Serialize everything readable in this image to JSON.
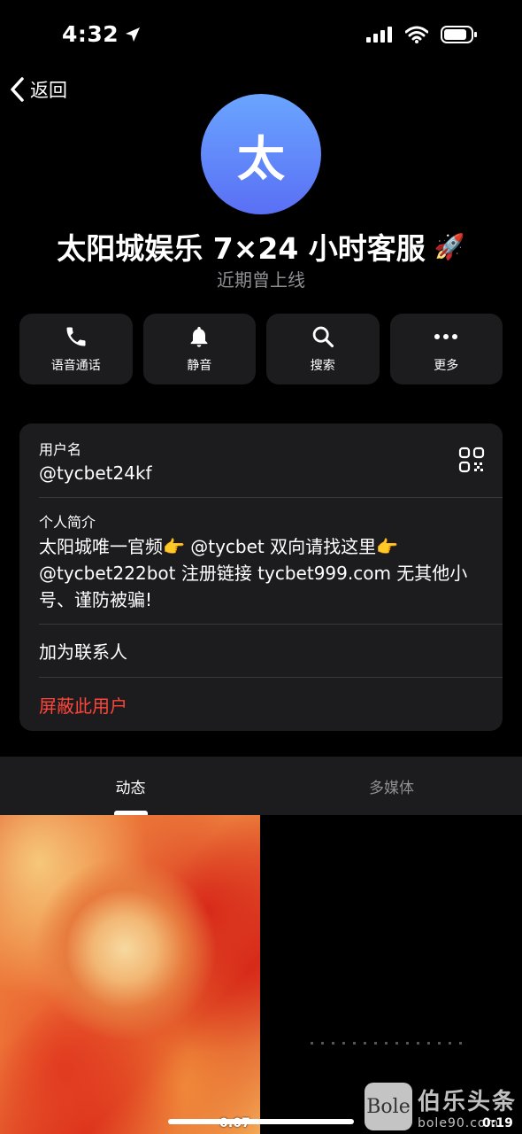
{
  "status_bar": {
    "time": "4:32"
  },
  "nav": {
    "back_label": "返回"
  },
  "profile": {
    "avatar_letter": "太",
    "name": "太阳城娱乐 7×24 小时客服",
    "name_emoji": "🚀",
    "last_seen": "近期曾上线"
  },
  "actions": [
    {
      "label": "语音通话",
      "icon": "phone-icon"
    },
    {
      "label": "静音",
      "icon": "bell-icon"
    },
    {
      "label": "搜索",
      "icon": "search-icon"
    },
    {
      "label": "更多",
      "icon": "more-icon"
    }
  ],
  "info": {
    "username_label": "用户名",
    "username": "@tycbet24kf",
    "bio_label": "个人简介",
    "bio": "太阳城唯一官频👉 @tycbet 双向请找这里👉 @tycbet222bot 注册链接 tycbet999.com 无其他小号、谨防被骗!",
    "add_contact": "加为联系人",
    "block_user": "屏蔽此用户"
  },
  "tabs": [
    {
      "label": "动态",
      "active": true
    },
    {
      "label": "多媒体",
      "active": false
    }
  ],
  "media": [
    {
      "duration": "0:07"
    },
    {
      "duration": "0:19"
    }
  ],
  "watermark": {
    "logo": "Bole",
    "name": "伯乐头条",
    "url": "bole90.com"
  },
  "colors": {
    "accent_red": "#ff453a",
    "card_bg": "#1c1c1e",
    "avatar_top": "#6aa5ff",
    "avatar_bottom": "#5a6ff5"
  }
}
